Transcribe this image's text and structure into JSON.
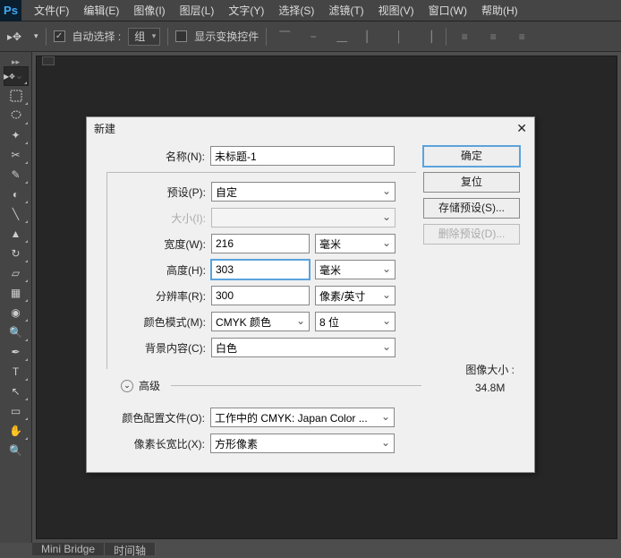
{
  "menu": [
    "文件(F)",
    "编辑(E)",
    "图像(I)",
    "图层(L)",
    "文字(Y)",
    "选择(S)",
    "滤镜(T)",
    "视图(V)",
    "窗口(W)",
    "帮助(H)"
  ],
  "toolbar": {
    "auto_select": "自动选择 :",
    "group": "组",
    "show_transform": "显示变换控件"
  },
  "dialog": {
    "title": "新建",
    "name_label": "名称(N):",
    "name_value": "未标题-1",
    "preset_label": "预设(P):",
    "preset_value": "自定",
    "size_label": "大小(I):",
    "width_label": "宽度(W):",
    "width_value": "216",
    "width_unit": "毫米",
    "height_label": "高度(H):",
    "height_value": "303",
    "height_unit": "毫米",
    "res_label": "分辨率(R):",
    "res_value": "300",
    "res_unit": "像素/英寸",
    "color_label": "颜色模式(M):",
    "color_value": "CMYK 颜色",
    "depth": "8 位",
    "bg_label": "背景内容(C):",
    "bg_value": "白色",
    "advanced": "高级",
    "profile_label": "颜色配置文件(O):",
    "profile_value": "工作中的 CMYK: Japan Color ...",
    "aspect_label": "像素长宽比(X):",
    "aspect_value": "方形像素",
    "ok": "确定",
    "cancel": "复位",
    "save_preset": "存储预设(S)...",
    "delete_preset": "删除预设(D)...",
    "image_size_label": "图像大小 :",
    "image_size_value": "34.8M"
  },
  "tabs": {
    "mini_bridge": "Mini Bridge",
    "timeline": "时间轴"
  }
}
